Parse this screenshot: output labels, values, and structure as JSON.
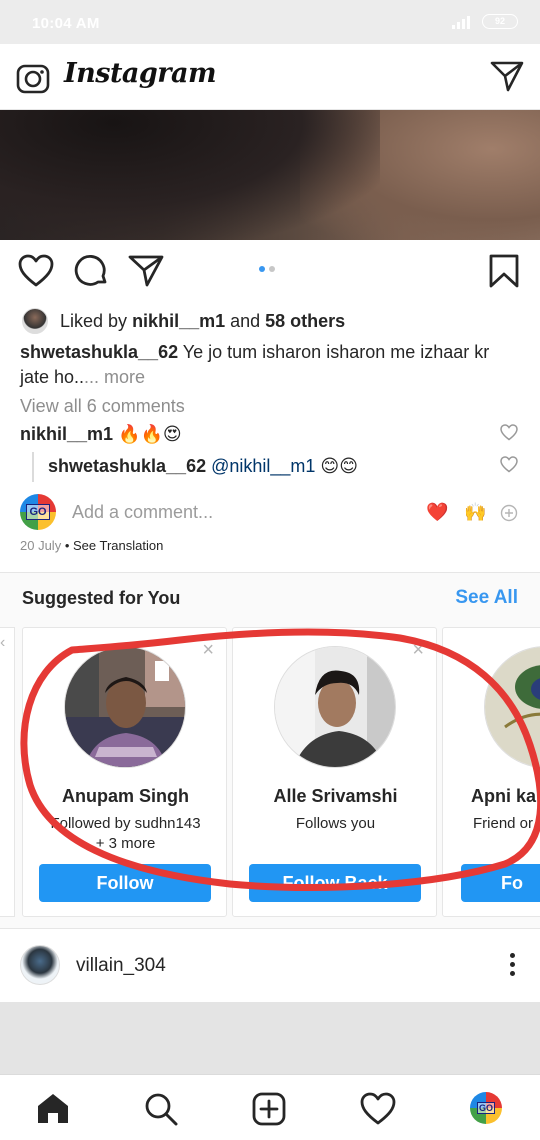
{
  "status_bar": {
    "time": "10:04 AM",
    "battery": "92"
  },
  "header": {
    "logo_text": "Instagram"
  },
  "post": {
    "liked_prefix": "Liked by ",
    "liked_user": "nikhil__m1",
    "liked_and": " and ",
    "liked_others": "58 others",
    "caption_user": "shwetashukla__62",
    "caption_text": " Ye jo tum isharon isharon me izhaar kr jate ho..",
    "caption_more": "... more",
    "view_comments": "View all 6 comments",
    "comment1_user": "nikhil__m1",
    "comment1_text": " 🔥🔥😍",
    "comment2_user": "shwetashukla__62",
    "comment2_mention": " @nikhil__m1",
    "comment2_text": " 😊😊",
    "add_comment_placeholder": "Add a comment...",
    "quick_heart": "❤️",
    "quick_hands": "🙌",
    "date": "20 July",
    "separator": " • ",
    "see_translation": "See Translation",
    "go_badge": "GO"
  },
  "suggested": {
    "title": "Suggested for You",
    "see_all": "See All",
    "cards": [
      {
        "name": "Anupam Singh",
        "sub_line1": "Followed by sudhn143",
        "sub_line2": "+ 3 more",
        "button": "Follow"
      },
      {
        "name": "Alle Srivamshi",
        "sub_line1": "Follows you",
        "sub_line2": "",
        "button": "Follow Back"
      },
      {
        "name": "Apni ka",
        "sub_line1": "Friend or",
        "sub_line2": "",
        "button": "Fo"
      }
    ],
    "dismiss_symbol": "×"
  },
  "next_post": {
    "username": "villain_304"
  },
  "colors": {
    "accent_blue": "#3897f0",
    "button_blue": "#2196f3",
    "annotation_red": "#e53935"
  }
}
